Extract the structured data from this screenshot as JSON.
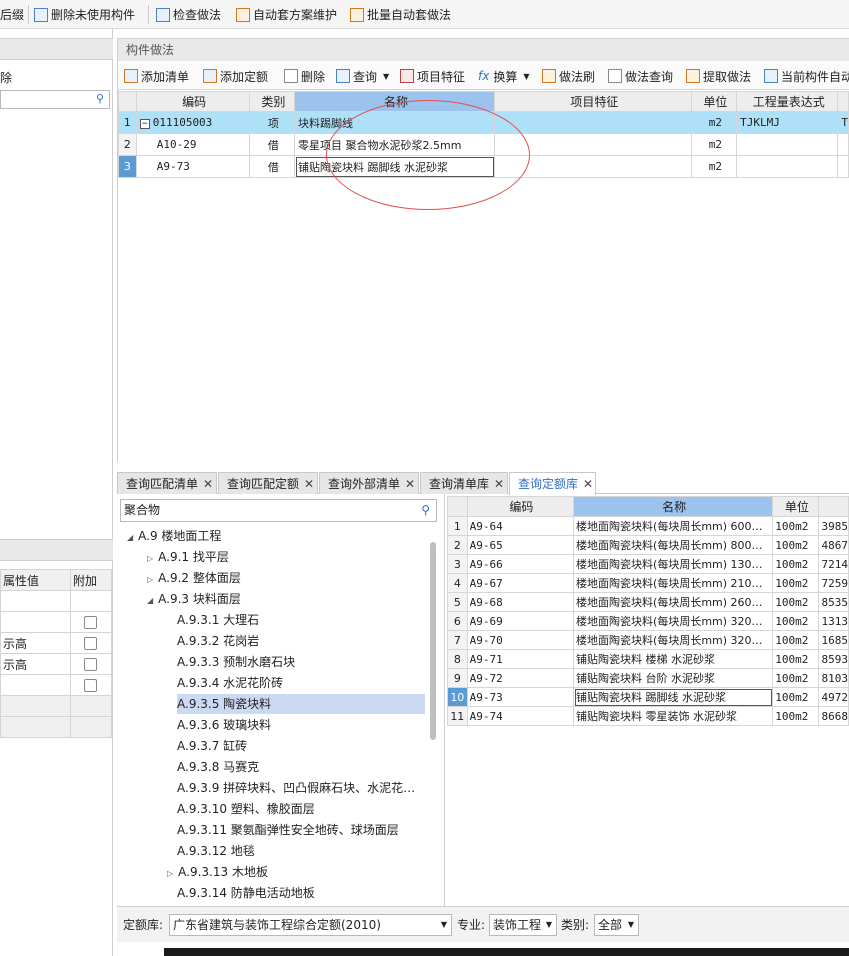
{
  "toolbar": {
    "suffix": "后缀",
    "delete_unused": "删除未使用构件",
    "check_method": "检查做法",
    "auto_scheme": "自动套方案维护",
    "batch_auto": "批量自动套做法"
  },
  "left_panel": {
    "delete": "除",
    "prop_header_value": "属性值",
    "prop_header_extra": "附加",
    "props": [
      "",
      "",
      "示高",
      "示高",
      ""
    ]
  },
  "main_panel": {
    "title": "构件做法",
    "tools": [
      "添加清单",
      "添加定额",
      "删除",
      "查询",
      "项目特征",
      "换算",
      "做法刷",
      "做法查询",
      "提取做法",
      "当前构件自动"
    ],
    "columns": [
      "编码",
      "类别",
      "名称",
      "项目特征",
      "单位",
      "工程量表达式"
    ],
    "rows": [
      {
        "num": "1",
        "code": "011105003",
        "type": "项",
        "name": "块料踢脚线",
        "feature": "",
        "unit": "m2",
        "expr": "TJKLMJ",
        "extra": "T"
      },
      {
        "num": "2",
        "code": "A10-29",
        "type": "借",
        "name": "零星项目 聚合物水泥砂浆2.5mm",
        "feature": "",
        "unit": "m2",
        "expr": "",
        "extra": ""
      },
      {
        "num": "3",
        "code": "A9-73",
        "type": "借",
        "name": "铺贴陶瓷块料 踢脚线 水泥砂浆",
        "feature": "",
        "unit": "m2",
        "expr": "",
        "extra": ""
      }
    ]
  },
  "bottom_panel": {
    "tabs": [
      "查询匹配清单",
      "查询匹配定额",
      "查询外部清单",
      "查询清单库",
      "查询定额库"
    ],
    "search_value": "聚合物",
    "tree": [
      {
        "label": "A.9 楼地面工程",
        "arrow": "◢"
      },
      {
        "label": "A.9.1 找平层",
        "arrow": "▷"
      },
      {
        "label": "A.9.2 整体面层",
        "arrow": "▷"
      },
      {
        "label": "A.9.3 块料面层",
        "arrow": "◢"
      },
      {
        "label": "A.9.3.1 大理石",
        "arrow": ""
      },
      {
        "label": "A.9.3.2 花岗岩",
        "arrow": ""
      },
      {
        "label": "A.9.3.3 预制水磨石块",
        "arrow": ""
      },
      {
        "label": "A.9.3.4 水泥花阶砖",
        "arrow": ""
      },
      {
        "label": "A.9.3.5 陶瓷块料",
        "arrow": ""
      },
      {
        "label": "A.9.3.6 玻璃块料",
        "arrow": ""
      },
      {
        "label": "A.9.3.7 缸砖",
        "arrow": ""
      },
      {
        "label": "A.9.3.8 马赛克",
        "arrow": ""
      },
      {
        "label": "A.9.3.9 拼碎块料、凹凸假麻石块、水泥花…",
        "arrow": ""
      },
      {
        "label": "A.9.3.10 塑料、橡胶面层",
        "arrow": ""
      },
      {
        "label": "A.9.3.11 聚氨酯弹性安全地砖、球场面层",
        "arrow": ""
      },
      {
        "label": "A.9.3.12 地毯",
        "arrow": ""
      },
      {
        "label": "A.9.3.13 木地板",
        "arrow": "▷"
      },
      {
        "label": "A.9.3.14 防静电活动地板",
        "arrow": ""
      }
    ],
    "columns": [
      "编码",
      "名称",
      "单位"
    ],
    "rows": [
      {
        "num": "1",
        "code": "A9-64",
        "name": "楼地面陶瓷块料(每块周长mm) 600…",
        "unit": "100m2",
        "price": "3985"
      },
      {
        "num": "2",
        "code": "A9-65",
        "name": "楼地面陶瓷块料(每块周长mm) 800…",
        "unit": "100m2",
        "price": "4867"
      },
      {
        "num": "3",
        "code": "A9-66",
        "name": "楼地面陶瓷块料(每块周长mm) 130…",
        "unit": "100m2",
        "price": "7214"
      },
      {
        "num": "4",
        "code": "A9-67",
        "name": "楼地面陶瓷块料(每块周长mm) 210…",
        "unit": "100m2",
        "price": "7259"
      },
      {
        "num": "5",
        "code": "A9-68",
        "name": "楼地面陶瓷块料(每块周长mm) 260…",
        "unit": "100m2",
        "price": "8535"
      },
      {
        "num": "6",
        "code": "A9-69",
        "name": "楼地面陶瓷块料(每块周长mm) 320…",
        "unit": "100m2",
        "price": "1313"
      },
      {
        "num": "7",
        "code": "A9-70",
        "name": "楼地面陶瓷块料(每块周长mm) 320…",
        "unit": "100m2",
        "price": "1685"
      },
      {
        "num": "8",
        "code": "A9-71",
        "name": "铺贴陶瓷块料 楼梯 水泥砂浆",
        "unit": "100m2",
        "price": "8593"
      },
      {
        "num": "9",
        "code": "A9-72",
        "name": "铺贴陶瓷块料 台阶 水泥砂浆",
        "unit": "100m2",
        "price": "8103"
      },
      {
        "num": "10",
        "code": "A9-73",
        "name": "铺贴陶瓷块料 踢脚线 水泥砂浆",
        "unit": "100m2",
        "price": "4972"
      },
      {
        "num": "11",
        "code": "A9-74",
        "name": "铺贴陶瓷块料 零星装饰 水泥砂浆",
        "unit": "100m2",
        "price": "8668"
      }
    ]
  },
  "footer": {
    "lib_label": "定额库:",
    "lib_value": "广东省建筑与装饰工程综合定额(2010)",
    "major_label": "专业:",
    "major_value": "装饰工程",
    "cat_label": "类别:",
    "cat_value": "全部"
  },
  "colors": {
    "selected_header": "#9cc3ee",
    "selected_row": "#aee0f8",
    "accent": "#2f6fc8",
    "annotation": "#e05050"
  }
}
